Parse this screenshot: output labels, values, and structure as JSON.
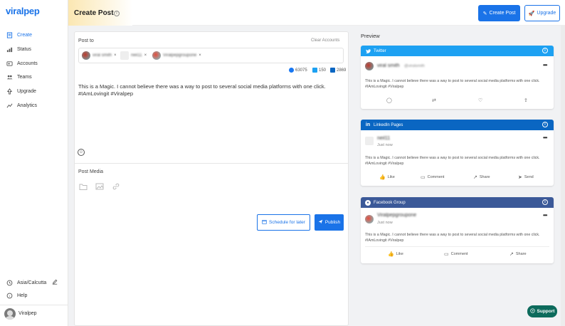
{
  "app": {
    "logo": "viralpep"
  },
  "sidebar": {
    "items": [
      {
        "label": "Create",
        "icon": "create-icon"
      },
      {
        "label": "Status",
        "icon": "status-icon"
      },
      {
        "label": "Accounts",
        "icon": "accounts-icon"
      },
      {
        "label": "Teams",
        "icon": "teams-icon"
      },
      {
        "label": "Upgrade",
        "icon": "upgrade-icon"
      },
      {
        "label": "Analytics",
        "icon": "analytics-icon"
      }
    ],
    "timezone": "Asia/Calcutta",
    "help": "Help",
    "user_name": "Viralpep"
  },
  "header": {
    "title": "Create Post",
    "create_post_button": "Create Post",
    "upgrade_button": "Upgrade"
  },
  "composer": {
    "post_to_label": "Post to",
    "clear_accounts": "Clear Accounts",
    "accounts": [
      {
        "name": "viral smith",
        "network": "twitter"
      },
      {
        "name": "neil11",
        "network": "linkedin"
      },
      {
        "name": "Viralpepgroupone",
        "network": "facebook"
      }
    ],
    "char_limits": {
      "facebook": "63075",
      "twitter": "150",
      "linkedin": "2869"
    },
    "text_line1": "This is a Magic. I cannot believe there was a way to post to several social media platforms with one click.",
    "text_line2": "#IAmLovingit #Viralpep",
    "post_media_label": "Post Media",
    "schedule_button": "Schedule for later",
    "publish_button": "Publish"
  },
  "preview": {
    "title": "Preview",
    "post_text_line1": "This is a Magic. I cannot believe there was a way to post to several social media platforms with one click.",
    "post_text_line2": "#IAmLovingit #Viralpep",
    "twitter": {
      "header": "Twitter",
      "name": "viral smith",
      "handle": "@viralsmith"
    },
    "linkedin": {
      "header": "LinkedIn Pages",
      "name": "neil11",
      "time": "Just now",
      "actions": [
        "Like",
        "Comment",
        "Share",
        "Send"
      ]
    },
    "facebook": {
      "header": "Facebook Group",
      "name": "Viralpepgroupone",
      "time": "Just now",
      "actions": [
        "Like",
        "Comment",
        "Share"
      ]
    }
  },
  "support_button": "Support",
  "colors": {
    "primary": "#1a73e8",
    "twitter": "#1da1f2",
    "linkedin": "#0a66c2",
    "facebook": "#3b5998",
    "support": "#0d6b5c"
  }
}
